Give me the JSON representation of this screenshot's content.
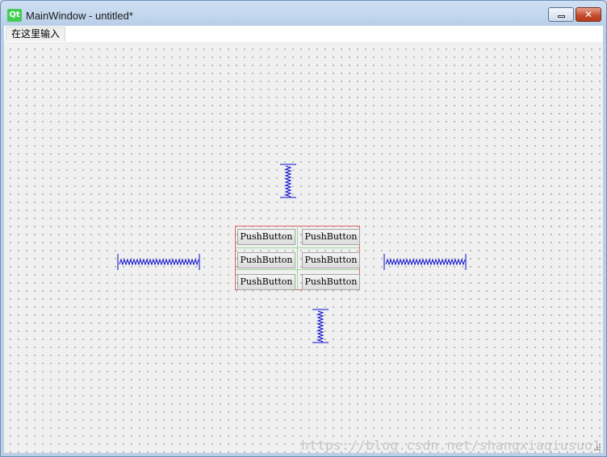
{
  "window": {
    "title": "MainWindow - untitled*",
    "logo_text": "Qt"
  },
  "menubar": {
    "items": [
      {
        "label": "在这里输入"
      }
    ]
  },
  "grid": {
    "buttons": [
      {
        "label": "PushButton"
      },
      {
        "label": "PushButton"
      },
      {
        "label": "PushButton"
      },
      {
        "label": "PushButton"
      },
      {
        "label": "PushButton"
      },
      {
        "label": "PushButton"
      }
    ]
  },
  "watermark": "https://blog.csdn.net/shangxiaqiusuo1",
  "colors": {
    "spacer": "#0a0ad2",
    "layout_border": "#e06868",
    "layout_inner": "#9ed69e",
    "qt_green": "#41cd52"
  }
}
